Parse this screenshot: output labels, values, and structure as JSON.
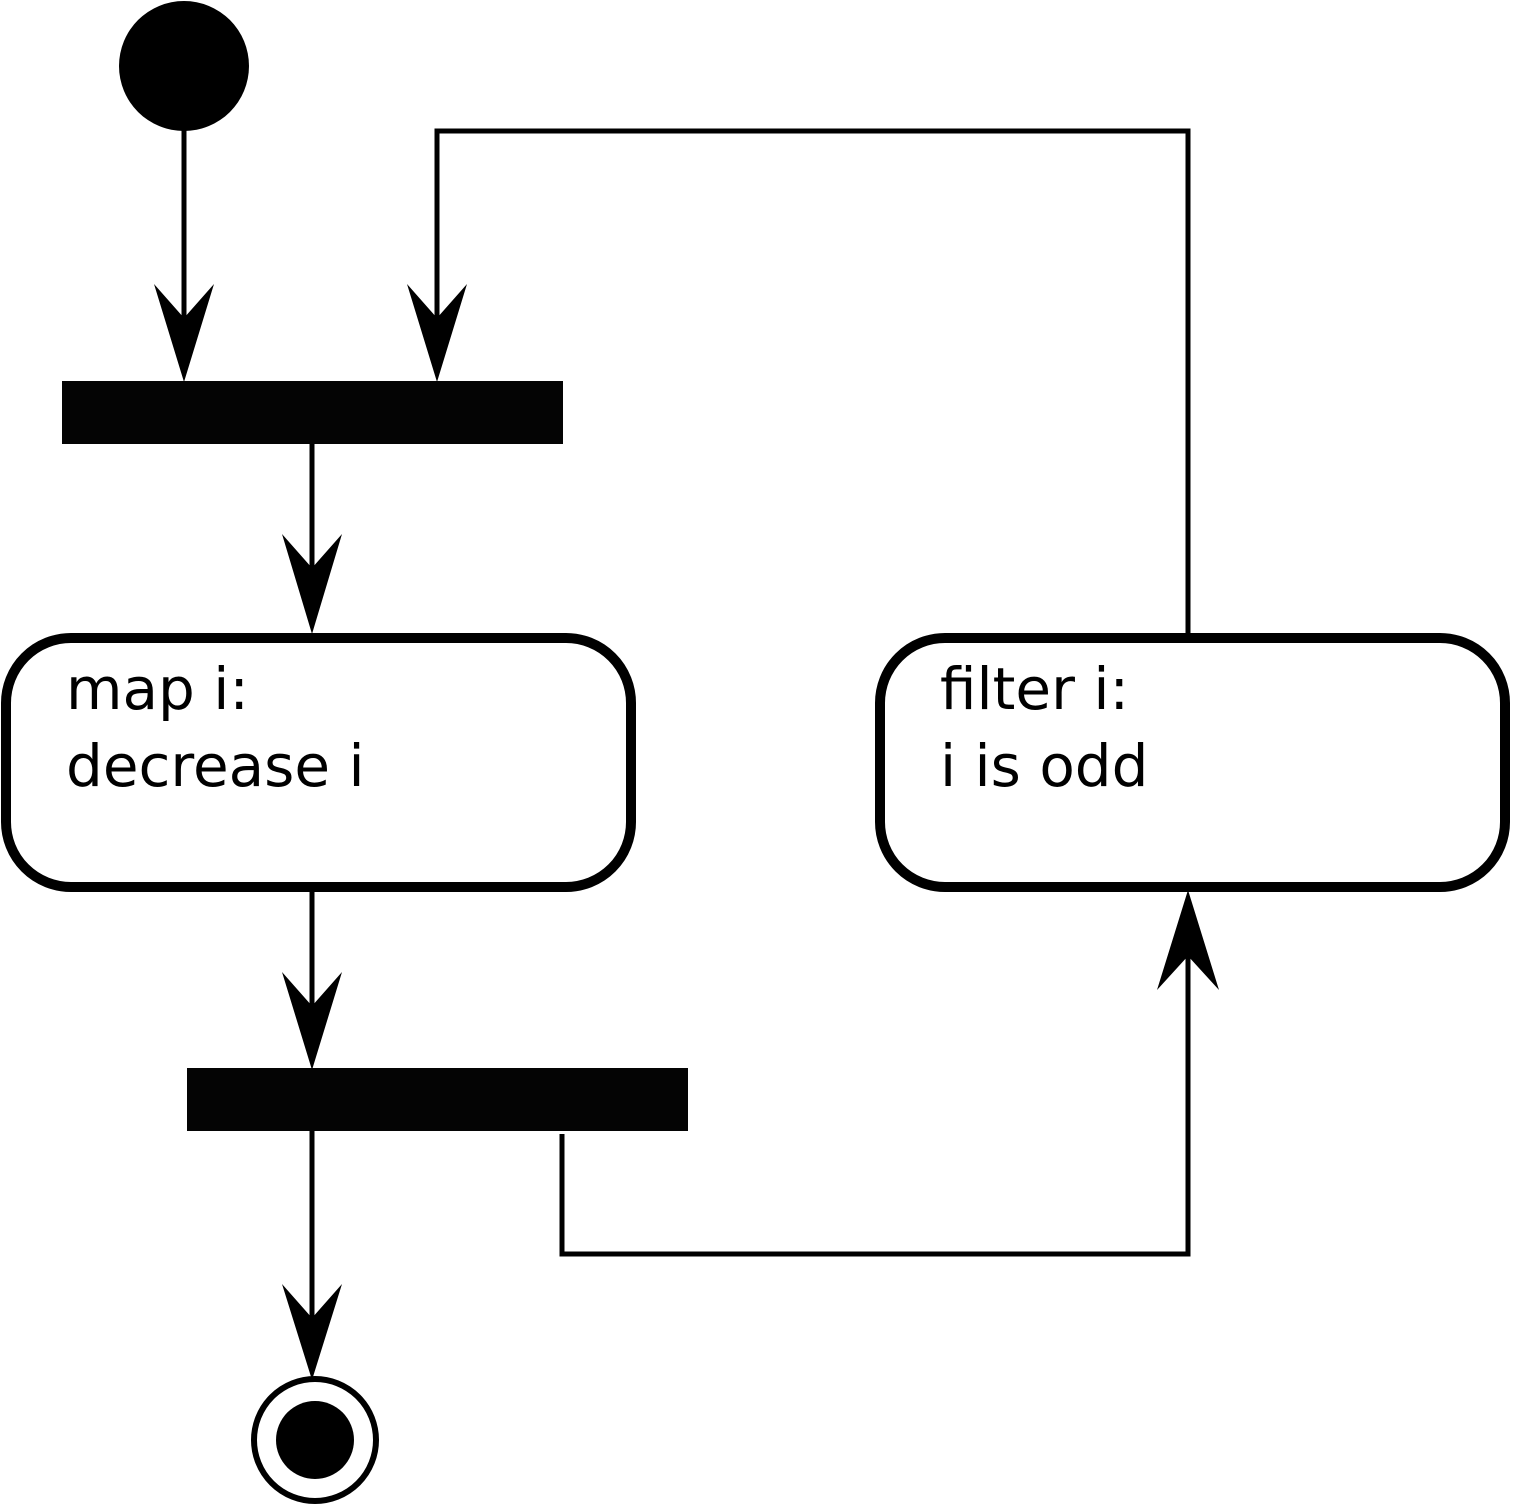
{
  "diagram": {
    "type": "uml-activity",
    "nodes": {
      "map_action": {
        "line1": "map i:",
        "line2": "decrease i"
      },
      "filter_action": {
        "line1": "filter i:",
        "line2": "i is odd"
      }
    },
    "colors": {
      "ink": "#000000",
      "bar": "#040404",
      "background": "#ffffff"
    }
  }
}
